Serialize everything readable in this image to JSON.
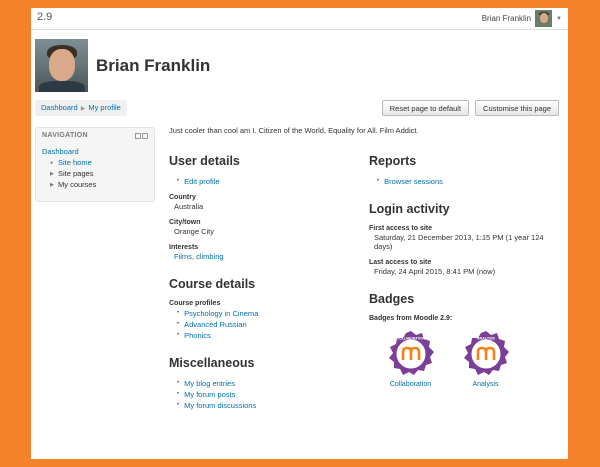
{
  "site": {
    "version": "2.9"
  },
  "user": {
    "menu_name": "Brian Franklin",
    "fullname": "Brian Franklin",
    "description": "Just cooler than cool am I. Citizen of the World, Equality for All. Film Addict."
  },
  "breadcrumb": [
    "Dashboard",
    "My profile"
  ],
  "buttons": {
    "reset": "Reset page to default",
    "customise": "Customise this page"
  },
  "navigation": {
    "title": "NAVIGATION",
    "dashboard": "Dashboard",
    "items": [
      "Site home",
      "Site pages",
      "My courses"
    ]
  },
  "user_details": {
    "heading": "User details",
    "edit_profile": "Edit profile",
    "country_label": "Country",
    "country": "Australia",
    "city_label": "City/town",
    "city": "Orange City",
    "interests_label": "Interests",
    "interests": "Films, climbing"
  },
  "course_details": {
    "heading": "Course details",
    "profiles_label": "Course profiles",
    "courses": [
      "Psychology in Cinema",
      "Advanced Russian",
      "Phonics"
    ]
  },
  "miscellaneous": {
    "heading": "Miscellaneous",
    "links": [
      "My blog entries",
      "My forum posts",
      "My forum discussions"
    ]
  },
  "reports": {
    "heading": "Reports",
    "links": [
      "Browser sessions"
    ]
  },
  "login_activity": {
    "heading": "Login activity",
    "first_label": "First access to site",
    "first_value": "Saturday, 21 December 2013, 1:15 PM  (1 year 124 days)",
    "last_label": "Last access to site",
    "last_value": "Friday, 24 April 2015, 8:41 PM  (now)"
  },
  "badges": {
    "heading": "Badges",
    "from_label": "Badges from Moodle 2.9:",
    "items": [
      {
        "name": "Collaboration",
        "ring_text": "COLLABORATION"
      },
      {
        "name": "Analysis",
        "ring_text": "ANALYSIS"
      }
    ],
    "colors": {
      "badge_purple": "#7b3f98",
      "moodle_orange": "#f98012"
    }
  },
  "colors": {
    "page_bg": "#f4822a",
    "link": "#0070a8"
  }
}
